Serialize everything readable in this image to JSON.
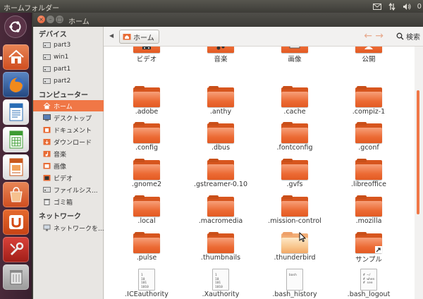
{
  "top_panel": {
    "title": "ホームフォルダー",
    "tray_number": "0",
    "icons": [
      "mail-icon",
      "network-updown-icon",
      "volume-icon"
    ]
  },
  "launcher": {
    "items": [
      "ubuntu-dash-icon",
      "home-folder-icon",
      "firefox-icon",
      "libreoffice-writer-icon",
      "libreoffice-calc-icon",
      "libreoffice-impress-icon",
      "ubuntu-software-center-icon",
      "ubuntu-one-icon",
      "system-settings-icon",
      "trash-icon"
    ]
  },
  "window": {
    "title": "ホーム"
  },
  "sidebar": {
    "devices_header": "デバイス",
    "devices": [
      "part3",
      "win1",
      "part1",
      "part2"
    ],
    "computer_header": "コンピューター",
    "computer": [
      "ホーム",
      "デスクトップ",
      "ドキュメント",
      "ダウンロード",
      "音楽",
      "画像",
      "ビデオ",
      "ファイルシス...",
      "ゴミ箱"
    ],
    "network_header": "ネットワーク",
    "network": [
      "ネットワークを..."
    ]
  },
  "toolbar": {
    "crumb": "ホーム",
    "back_arrow": "←",
    "forward_arrow": "→",
    "search_label": "検索"
  },
  "files": {
    "row0": [
      "ビデオ",
      "音楽",
      "画像",
      "公開"
    ],
    "row1": [
      ".adobe",
      ".anthy",
      ".cache",
      ".compiz-1"
    ],
    "row2": [
      ".config",
      ".dbus",
      ".fontconfig",
      ".gconf"
    ],
    "row3": [
      ".gnome2",
      ".gstreamer-0.10",
      ".gvfs",
      ".libreoffice"
    ],
    "row4": [
      ".local",
      ".macromedia",
      ".mission-control",
      ".mozilla"
    ],
    "row5": [
      ".pulse",
      ".thumbnails",
      ".thunderbird",
      "サンプル"
    ],
    "row6": [
      ".ICEauthority",
      ".Xauthority",
      ".bash_history",
      ".bash_logout"
    ]
  },
  "doc_texts": {
    "binary": "1\n10\n101\n1010",
    "text": "bash\n\n\n",
    "script": "# ~/\n# when\n# see"
  },
  "colors": {
    "accent": "#f07746",
    "folder": "#e35a22"
  }
}
